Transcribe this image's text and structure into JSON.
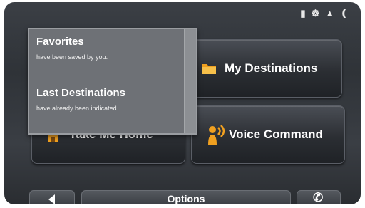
{
  "status_icons": [
    "battery-icon",
    "signal-icon",
    "traffic-alert-icon",
    "gps-icon"
  ],
  "tiles": {
    "my_destinations": {
      "label": "My Destinations",
      "icon": "folder-icon"
    },
    "voice_command": {
      "label": "Voice Command",
      "icon": "voice-icon"
    },
    "take_me_home": {
      "label": "Take Me Home",
      "icon": "house-icon"
    }
  },
  "popup": {
    "items": [
      {
        "title": "Favorites",
        "subtitle": "have been saved by you."
      },
      {
        "title": "Last Destinations",
        "subtitle": "have already been indicated."
      }
    ]
  },
  "bottom_bar": {
    "back_icon": "back-arrow-icon",
    "options_label": "Options",
    "phone_icon": "phone-icon"
  },
  "colors": {
    "accent_orange": "#f0a020",
    "screen_bg": "#33363b"
  }
}
